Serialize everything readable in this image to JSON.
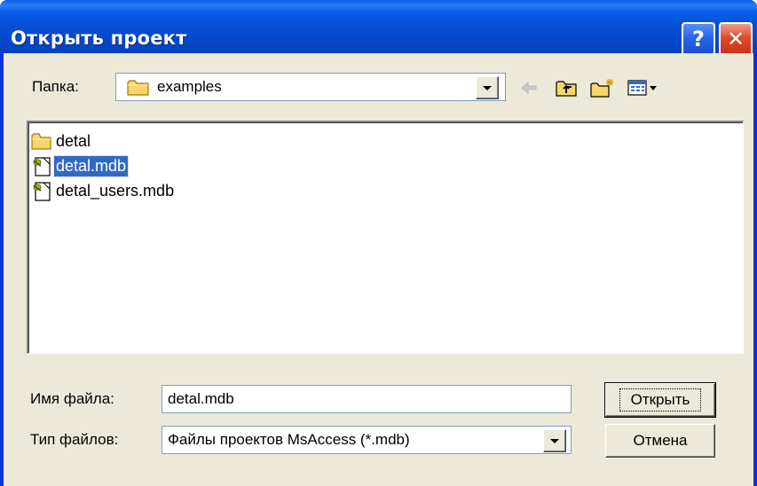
{
  "window": {
    "title": "Открыть проект"
  },
  "lookin": {
    "label": "Папка:",
    "value": "examples"
  },
  "toolbar": {
    "back": "back-icon",
    "up": "up-folder-icon",
    "newfolder": "new-folder-icon",
    "view": "view-menu-icon"
  },
  "files": [
    {
      "name": "detal",
      "type": "folder",
      "selected": false
    },
    {
      "name": "detal.mdb",
      "type": "mdb",
      "selected": true
    },
    {
      "name": "detal_users.mdb",
      "type": "mdb",
      "selected": false
    }
  ],
  "filename": {
    "label": "Имя файла:",
    "value": "detal.mdb"
  },
  "filetype": {
    "label": "Тип файлов:",
    "value": "Файлы проектов MsAccess (*.mdb)"
  },
  "buttons": {
    "open": "Открыть",
    "cancel": "Отмена"
  },
  "colors": {
    "titlebar": "#0a5ee8",
    "dialog_bg": "#ece9d8",
    "selection": "#316ac5"
  }
}
